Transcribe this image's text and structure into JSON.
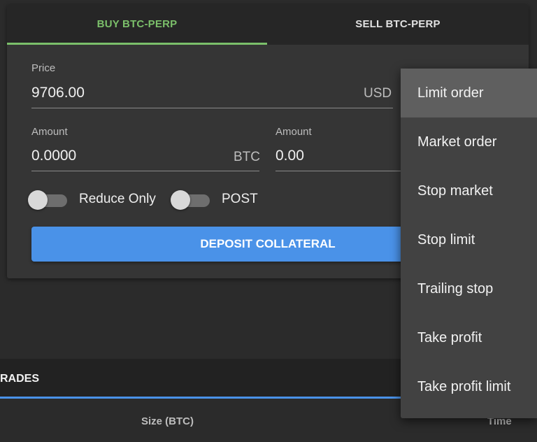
{
  "order_form": {
    "tabs": {
      "buy": "BUY BTC-PERP",
      "sell": "SELL BTC-PERP",
      "active": "buy"
    },
    "price": {
      "label": "Price",
      "value": "9706.00",
      "unit": "USD"
    },
    "amount_btc": {
      "label": "Amount",
      "value": "0.0000",
      "unit": "BTC"
    },
    "amount_usd": {
      "label": "Amount",
      "value": "0.00"
    },
    "toggles": [
      {
        "label": "Reduce Only",
        "on": false
      },
      {
        "label": "POST",
        "on": false
      }
    ],
    "deposit_button": "DEPOSIT COLLATERAL"
  },
  "trades": {
    "title": "T TRADES",
    "columns": {
      "size": "Size (BTC)",
      "time": "Time"
    }
  },
  "order_type_menu": {
    "items": [
      "Limit order",
      "Market order",
      "Stop market",
      "Stop limit",
      "Trailing stop",
      "Take profit",
      "Take profit limit"
    ],
    "selected": "Limit order"
  },
  "colors": {
    "background": "#2b2b2b",
    "panel": "#353535",
    "buy_accent": "#7bbf6a",
    "primary_button": "#4a92e8",
    "menu": "#424242",
    "menu_selected": "#5f5f5f"
  }
}
